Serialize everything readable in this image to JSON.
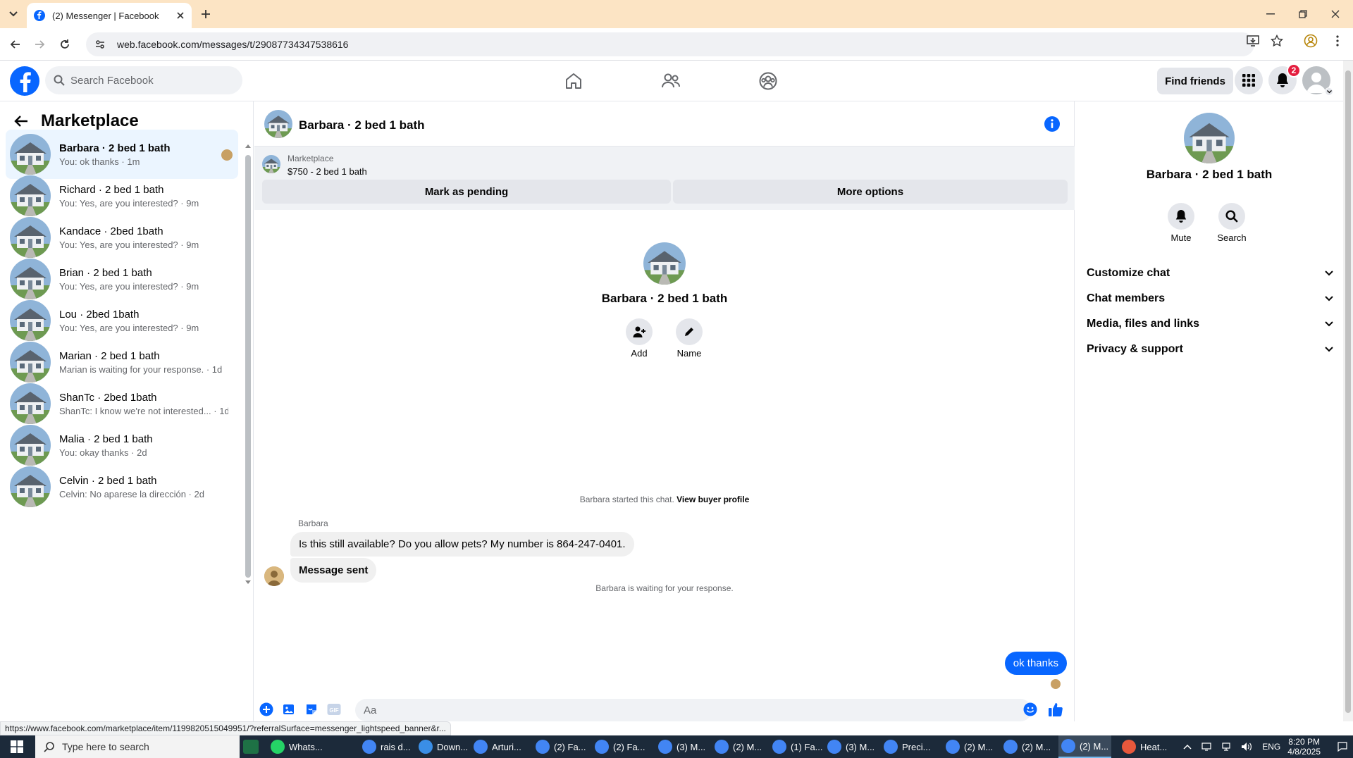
{
  "browser": {
    "tab_title": "(2) Messenger | Facebook",
    "url": "web.facebook.com/messages/t/29087734347538616",
    "status_url": "https://www.facebook.com/marketplace/item/1199820515049951/?referralSurface=messenger_lightspeed_banner&r..."
  },
  "fb_header": {
    "search_placeholder": "Search Facebook",
    "find_friends": "Find friends",
    "notification_count": "2"
  },
  "sidebar": {
    "title": "Marketplace",
    "conversations": [
      {
        "name": "Barbara · 2 bed 1 bath",
        "preview": "You: ok thanks · 1m"
      },
      {
        "name": "Richard · 2 bed 1 bath",
        "preview": "You: Yes, are you interested? · 9m"
      },
      {
        "name": "Kandace · 2bed 1bath",
        "preview": "You: Yes, are you interested? · 9m"
      },
      {
        "name": "Brian · 2 bed 1 bath",
        "preview": "You: Yes, are you interested? · 9m"
      },
      {
        "name": "Lou · 2bed 1bath",
        "preview": "You: Yes, are you interested? · 9m"
      },
      {
        "name": "Marian · 2 bed 1 bath",
        "preview": "Marian is waiting for your response. · 1d"
      },
      {
        "name": "ShanTc · 2bed 1bath",
        "preview": "ShanTc: I know we're not interested... · 1d"
      },
      {
        "name": "Malia · 2 bed 1 bath",
        "preview": "You: okay thanks · 2d"
      },
      {
        "name": "Celvin · 2 bed 1 bath",
        "preview": "Celvin: No aparese la dirección · 2d"
      }
    ]
  },
  "chat": {
    "title": "Barbara · 2 bed 1 bath",
    "marketplace_label": "Marketplace",
    "listing_price": "$750 - 2 bed 1 bath",
    "mark_pending": "Mark as pending",
    "more_options": "More options",
    "center_name": "Barbara · 2 bed 1 bath",
    "add_label": "Add",
    "name_label": "Name",
    "started_text": "Barbara started this chat.",
    "view_profile": "View buyer profile",
    "sender_name": "Barbara",
    "messages_in": [
      "Is this still available? Do you allow pets? My number is 864-247-0401.",
      "Message sent"
    ],
    "waiting_text": "Barbara is waiting for your response.",
    "message_out": "ok thanks",
    "composer_placeholder": "Aa"
  },
  "info_panel": {
    "name": "Barbara · 2 bed 1 bath",
    "mute": "Mute",
    "search": "Search",
    "sections": [
      "Customize chat",
      "Chat members",
      "Media, files and links",
      "Privacy & support"
    ]
  },
  "taskbar": {
    "search_placeholder": "Type here to search",
    "apps": [
      "Whats...",
      "rais d...",
      "Down...",
      "Arturi...",
      "(2) Fa...",
      "(2) Fa...",
      "(3) M...",
      "(2) M...",
      "(1) Fa...",
      "(3) M...",
      "Preci...",
      "(2) M...",
      "(2) M...",
      "(2) M...",
      "Heat..."
    ],
    "lang": "ENG",
    "time": "8:20 PM",
    "date": "4/8/2025"
  },
  "colors": {
    "fb_blue": "#0866ff",
    "tab_bar": "#fce4c4",
    "badge_red": "#e41e3f"
  }
}
